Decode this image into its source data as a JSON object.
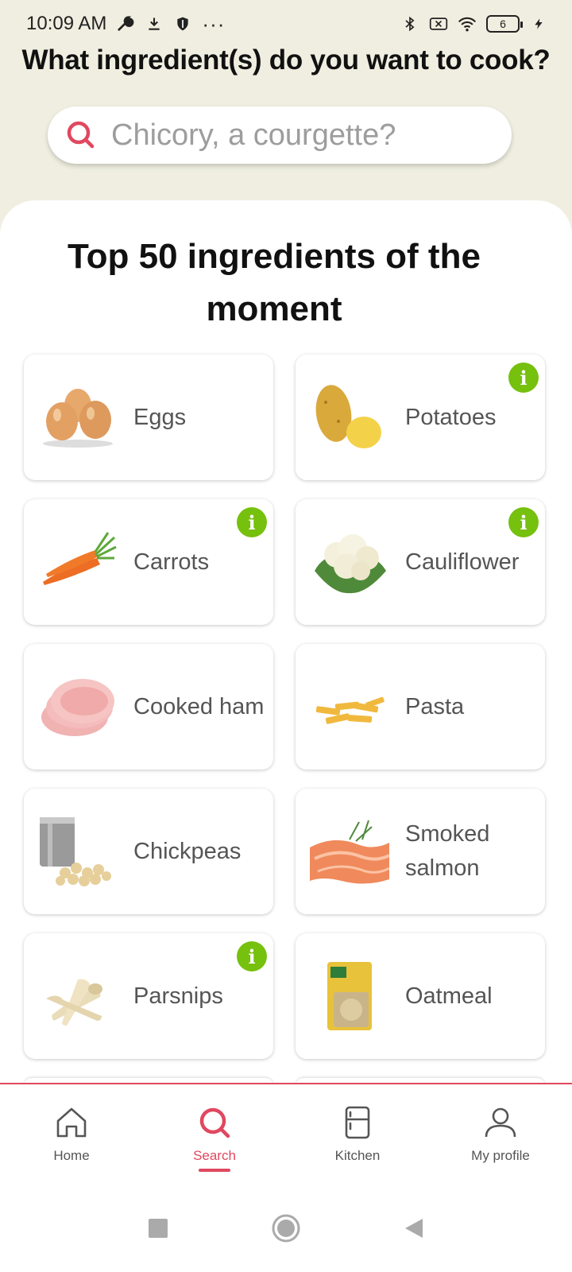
{
  "status_bar": {
    "time": "10:09 AM",
    "more": "···",
    "battery": "6",
    "icons": [
      "wrench-icon",
      "download-icon",
      "shield-icon",
      "bluetooth-icon",
      "no-sim-icon",
      "wifi-icon",
      "battery-icon",
      "charging-icon"
    ]
  },
  "header": {
    "question": "What ingredient(s) do you want to cook?"
  },
  "search": {
    "placeholder": "Chicory, a courgette?"
  },
  "section": {
    "title": "Top 50 ingredients of the moment"
  },
  "ingredients": [
    {
      "label": "Eggs",
      "info": false,
      "icon": "eggs-image"
    },
    {
      "label": "Potatoes",
      "info": true,
      "icon": "potatoes-image"
    },
    {
      "label": "Carrots",
      "info": true,
      "icon": "carrots-image"
    },
    {
      "label": "Cauliflower",
      "info": true,
      "icon": "cauliflower-image"
    },
    {
      "label": "Cooked ham",
      "info": false,
      "icon": "ham-image"
    },
    {
      "label": "Pasta",
      "info": false,
      "icon": "pasta-image"
    },
    {
      "label": "Chickpeas",
      "info": false,
      "icon": "chickpeas-image"
    },
    {
      "label": "Smoked salmon",
      "info": false,
      "icon": "salmon-image"
    },
    {
      "label": "Parsnips",
      "info": true,
      "icon": "parsnips-image"
    },
    {
      "label": "Oatmeal",
      "info": false,
      "icon": "oatmeal-image"
    }
  ],
  "info_badge": "i",
  "bottom_nav": {
    "items": [
      {
        "label": "Home",
        "icon": "home-icon"
      },
      {
        "label": "Search",
        "icon": "search-icon",
        "active": true
      },
      {
        "label": "Kitchen",
        "icon": "fridge-icon"
      },
      {
        "label": "My profile",
        "icon": "profile-icon"
      }
    ]
  },
  "colors": {
    "accent": "#e0485f",
    "info": "#76c00e",
    "background": "#efeee0"
  }
}
